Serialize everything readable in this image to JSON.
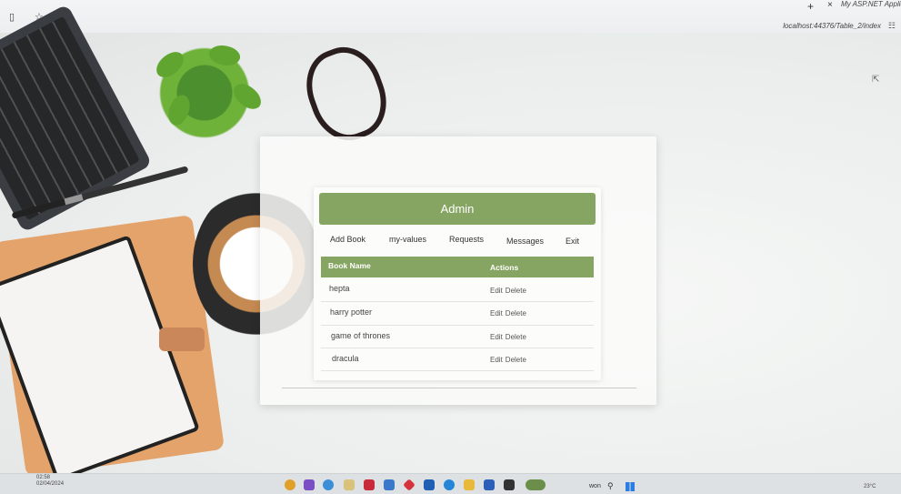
{
  "browser": {
    "tab_title": "My ASP.NET Applic",
    "new_tab": "+",
    "close_tab": "×",
    "address": "localhost:44376/Table_2/index"
  },
  "admin": {
    "title": "Admin",
    "nav": [
      "Add Book",
      "my-values",
      "Requests",
      "Messages",
      "Exit"
    ],
    "table": {
      "headers": [
        "Book Name",
        "Actions"
      ],
      "rows": [
        {
          "name": "hepta",
          "edit": "Edit",
          "delete": "Delete"
        },
        {
          "name": "harry potter",
          "edit": "Edit",
          "delete": "Delete"
        },
        {
          "name": "game of thrones",
          "edit": "Edit",
          "delete": "Delete"
        },
        {
          "name": "dracula",
          "edit": "Edit",
          "delete": "Delete"
        }
      ]
    }
  },
  "taskbar": {
    "time": "02:58",
    "date": "02/04/2024",
    "search_label": "won",
    "tray_text": "23°C"
  },
  "colors": {
    "accent": "#86a462",
    "panel": "#fafaf9"
  }
}
